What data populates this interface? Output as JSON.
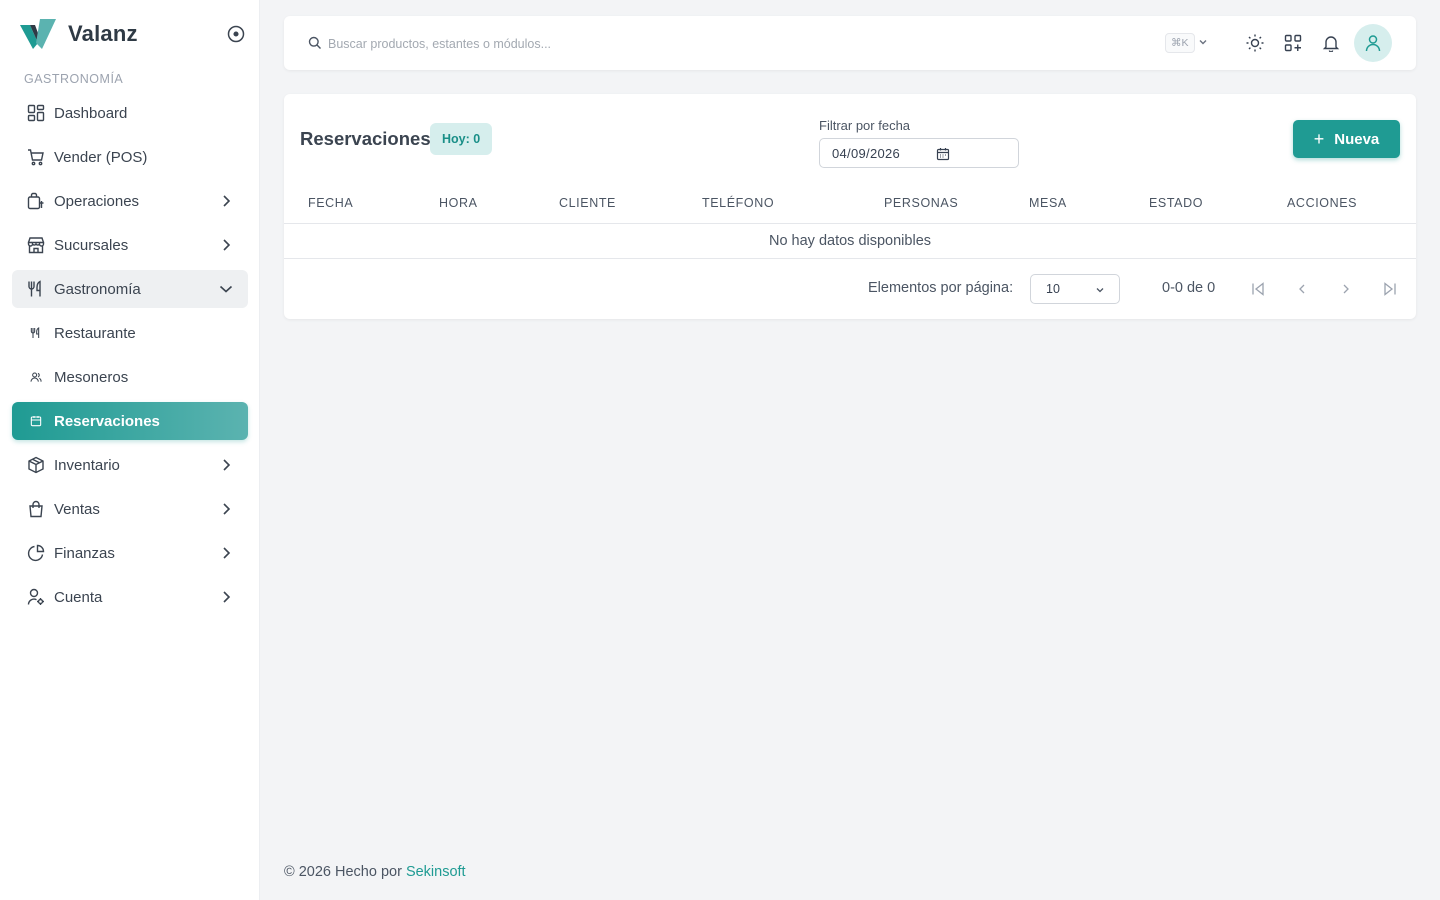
{
  "app": {
    "name": "Valanz"
  },
  "colors": {
    "accent": "#1f9b93",
    "accent_light": "#d6eeed"
  },
  "sidebar": {
    "section": "GASTRONOMÍA",
    "items": [
      {
        "label": "Dashboard",
        "icon": "dashboard-icon"
      },
      {
        "label": "Vender (POS)",
        "icon": "cart-icon"
      },
      {
        "label": "Operaciones",
        "icon": "operations-icon"
      },
      {
        "label": "Sucursales",
        "icon": "store-icon"
      },
      {
        "label": "Gastronomía",
        "icon": "utensils-icon"
      },
      {
        "label": "Restaurante",
        "icon": "utensils-small-icon"
      },
      {
        "label": "Mesoneros",
        "icon": "users-icon"
      },
      {
        "label": "Reservaciones",
        "icon": "calendar-icon"
      },
      {
        "label": "Inventario",
        "icon": "box-icon"
      },
      {
        "label": "Ventas",
        "icon": "bag-icon"
      },
      {
        "label": "Finanzas",
        "icon": "pie-chart-icon"
      },
      {
        "label": "Cuenta",
        "icon": "user-gear-icon"
      }
    ]
  },
  "topbar": {
    "search_placeholder": "Buscar productos, estantes o módulos...",
    "shortcut": "⌘K"
  },
  "page": {
    "title": "Reservaciones",
    "today_badge": "Hoy: 0",
    "filter_label": "Filtrar por fecha",
    "filter_date": "04/09/2026",
    "new_button": "Nueva"
  },
  "table": {
    "columns": [
      "FECHA",
      "HORA",
      "CLIENTE",
      "TELÉFONO",
      "PERSONAS",
      "MESA",
      "ESTADO",
      "ACCIONES"
    ],
    "rows": [],
    "empty_text": "No hay datos disponibles"
  },
  "pagination": {
    "per_page_label": "Elementos por página:",
    "per_page_value": "10",
    "range": "0-0 de 0"
  },
  "footer": {
    "text": "© 2026 Hecho por ",
    "link": "Sekinsoft"
  }
}
